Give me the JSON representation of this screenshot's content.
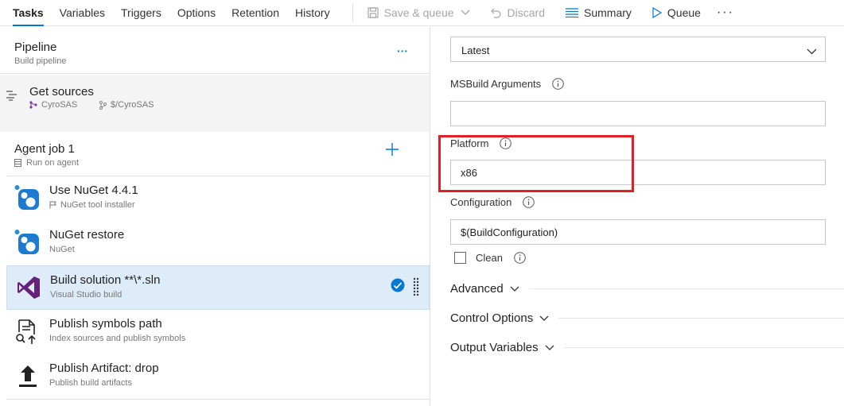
{
  "toolbar": {
    "tabs": [
      "Tasks",
      "Variables",
      "Triggers",
      "Options",
      "Retention",
      "History"
    ],
    "save_queue": "Save & queue",
    "discard": "Discard",
    "summary": "Summary",
    "queue": "Queue",
    "more": "···"
  },
  "pipeline": {
    "title": "Pipeline",
    "subtitle": "Build pipeline",
    "menu": "···"
  },
  "get_sources": {
    "title": "Get sources",
    "repo": "CyroSAS",
    "path": "$/CyroSAS"
  },
  "agent_job": {
    "title": "Agent job 1",
    "subtitle": "Run on agent",
    "add": "+"
  },
  "tasks": [
    {
      "title": "Use NuGet 4.4.1",
      "subtitle": "NuGet tool installer",
      "icon": "nuget-icon"
    },
    {
      "title": "NuGet restore",
      "subtitle": "NuGet",
      "icon": "nuget-icon"
    },
    {
      "title": "Build solution **\\*.sln",
      "subtitle": "Visual Studio build",
      "icon": "visual-studio-icon"
    },
    {
      "title": "Publish symbols path",
      "subtitle": "Index sources and publish symbols",
      "icon": "publish-symbols-icon"
    },
    {
      "title": "Publish Artifact: drop",
      "subtitle": "Publish build artifacts",
      "icon": "upload-icon"
    }
  ],
  "form": {
    "version_select": "Latest",
    "msbuild_label": "MSBuild Arguments",
    "msbuild_value": "",
    "platform_label": "Platform",
    "platform_value": "x86",
    "configuration_label": "Configuration",
    "configuration_value": "$(BuildConfiguration)",
    "clean_label": "Clean",
    "sections": [
      "Advanced",
      "Control Options",
      "Output Variables"
    ]
  },
  "colors": {
    "accent": "#0078d4",
    "highlight": "#e01f2b",
    "selected_bg": "#deecf9"
  }
}
